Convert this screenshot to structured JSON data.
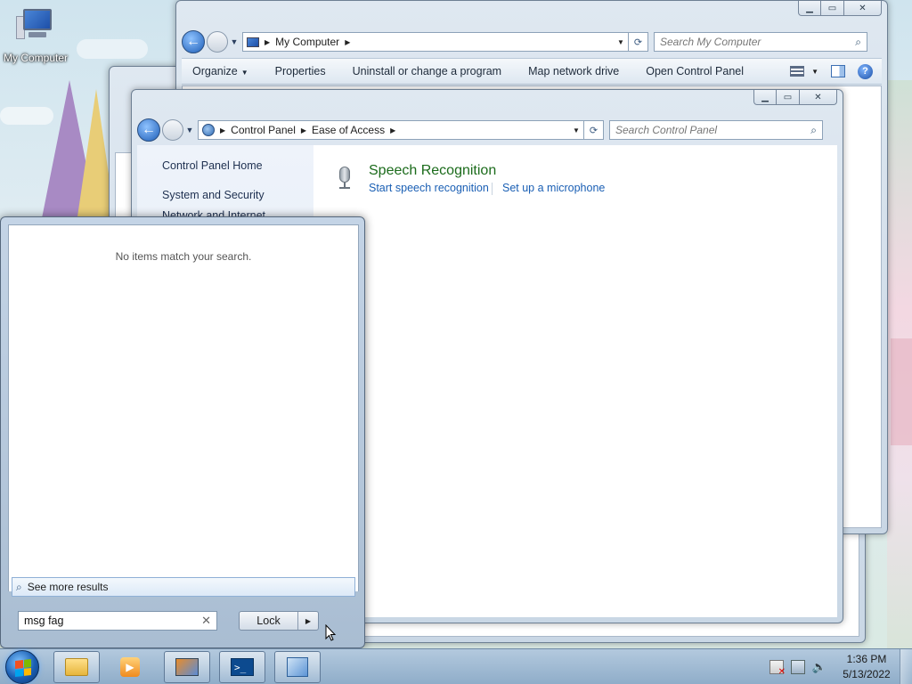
{
  "desktop": {
    "icons": [
      {
        "label": "My Computer"
      }
    ]
  },
  "window_my_computer": {
    "address": {
      "segments": [
        "My Computer"
      ]
    },
    "search_placeholder": "Search My Computer",
    "commands": [
      "Organize",
      "Properties",
      "Uninstall or change a program",
      "Map network drive",
      "Open Control Panel"
    ]
  },
  "window_control_panel": {
    "address": {
      "segments": [
        "Control Panel",
        "Ease of Access"
      ]
    },
    "search_placeholder": "Search Control Panel",
    "nav": [
      "Control Panel Home",
      "System and Security",
      "Network and Internet"
    ],
    "category": {
      "title": "Speech Recognition",
      "links": [
        "Start speech recognition",
        "Set up a microphone"
      ]
    }
  },
  "start_menu": {
    "no_results": "No items match your search.",
    "see_more": "See more results",
    "search_value": "msg fag",
    "power_button": "Lock"
  },
  "taskbar": {
    "clock_time": "1:36 PM",
    "clock_date": "5/13/2022"
  },
  "icons": {
    "start": "windows-orb-icon",
    "explorer": "folder-icon",
    "media": "media-player-icon",
    "mypc": "my-computer-icon",
    "powershell": "powershell-icon",
    "control_panel": "control-panel-icon",
    "action_center": "action-center-flag-icon",
    "network": "network-icon",
    "volume": "speaker-icon"
  },
  "colors": {
    "link": "#1a5fb4",
    "category_title": "#1b6b1b",
    "taskbar": "#8fadc9"
  }
}
